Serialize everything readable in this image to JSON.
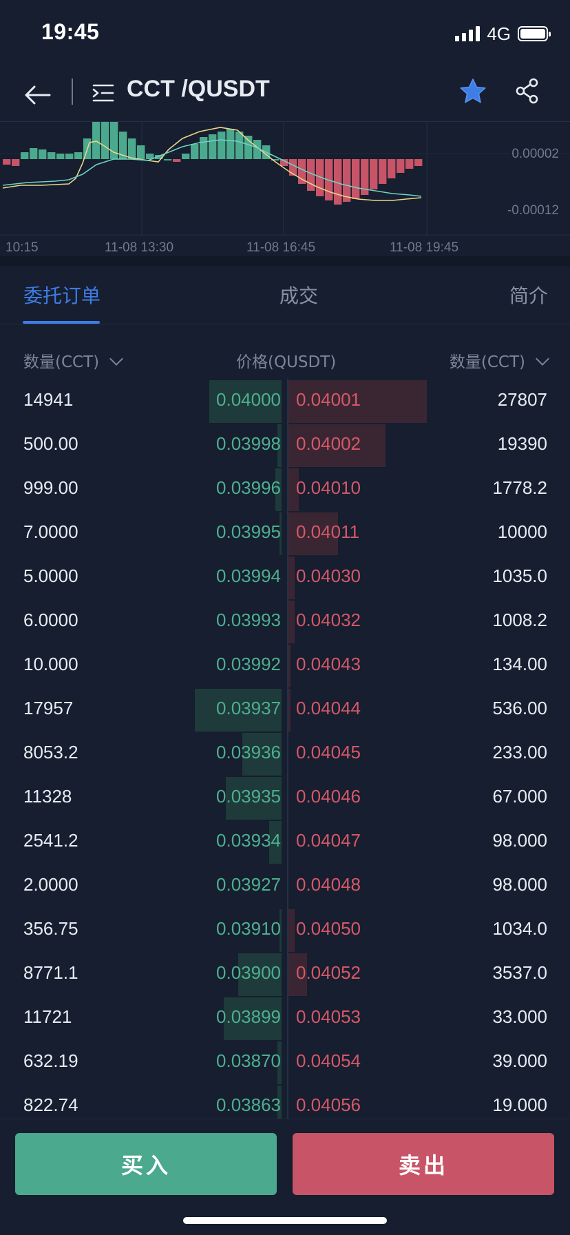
{
  "status_bar": {
    "time": "19:45",
    "network": "4G"
  },
  "header": {
    "pair": "CCT /QUSDT"
  },
  "chart": {
    "y_labels": [
      "0.00002",
      "-0.00012"
    ],
    "x_labels": [
      "10:15",
      "11-08 13:30",
      "11-08 16:45",
      "11-08 19:45"
    ]
  },
  "tabs": [
    "委托订单",
    "成交",
    "简介"
  ],
  "columns": {
    "left_qty": "数量(CCT)",
    "price": "价格(QUSDT)",
    "right_qty": "数量(CCT)"
  },
  "orderbook": [
    {
      "bid_qty": "14941",
      "bid": "0.04000",
      "ask": "0.04001",
      "ask_qty": "27807",
      "bid_depth": 0.35,
      "ask_depth": 0.67
    },
    {
      "bid_qty": "500.00",
      "bid": "0.03998",
      "ask": "0.04002",
      "ask_qty": "19390",
      "bid_depth": 0.02,
      "ask_depth": 0.47
    },
    {
      "bid_qty": "999.00",
      "bid": "0.03996",
      "ask": "0.04010",
      "ask_qty": "1778.2",
      "bid_depth": 0.03,
      "ask_depth": 0.05
    },
    {
      "bid_qty": "7.0000",
      "bid": "0.03995",
      "ask": "0.04011",
      "ask_qty": "10000",
      "bid_depth": 0.01,
      "ask_depth": 0.24
    },
    {
      "bid_qty": "5.0000",
      "bid": "0.03994",
      "ask": "0.04030",
      "ask_qty": "1035.0",
      "bid_depth": 0.0,
      "ask_depth": 0.03
    },
    {
      "bid_qty": "6.0000",
      "bid": "0.03993",
      "ask": "0.04032",
      "ask_qty": "1008.2",
      "bid_depth": 0.0,
      "ask_depth": 0.03
    },
    {
      "bid_qty": "10.000",
      "bid": "0.03992",
      "ask": "0.04043",
      "ask_qty": "134.00",
      "bid_depth": 0.0,
      "ask_depth": 0.01
    },
    {
      "bid_qty": "17957",
      "bid": "0.03937",
      "ask": "0.04044",
      "ask_qty": "536.00",
      "bid_depth": 0.42,
      "ask_depth": 0.01
    },
    {
      "bid_qty": "8053.2",
      "bid": "0.03936",
      "ask": "0.04045",
      "ask_qty": "233.00",
      "bid_depth": 0.19,
      "ask_depth": 0.0
    },
    {
      "bid_qty": "11328",
      "bid": "0.03935",
      "ask": "0.04046",
      "ask_qty": "67.000",
      "bid_depth": 0.27,
      "ask_depth": 0.0
    },
    {
      "bid_qty": "2541.2",
      "bid": "0.03934",
      "ask": "0.04047",
      "ask_qty": "98.000",
      "bid_depth": 0.06,
      "ask_depth": 0.0
    },
    {
      "bid_qty": "2.0000",
      "bid": "0.03927",
      "ask": "0.04048",
      "ask_qty": "98.000",
      "bid_depth": 0.0,
      "ask_depth": 0.0
    },
    {
      "bid_qty": "356.75",
      "bid": "0.03910",
      "ask": "0.04050",
      "ask_qty": "1034.0",
      "bid_depth": 0.01,
      "ask_depth": 0.03
    },
    {
      "bid_qty": "8771.1",
      "bid": "0.03900",
      "ask": "0.04052",
      "ask_qty": "3537.0",
      "bid_depth": 0.21,
      "ask_depth": 0.09
    },
    {
      "bid_qty": "11721",
      "bid": "0.03899",
      "ask": "0.04053",
      "ask_qty": "33.000",
      "bid_depth": 0.28,
      "ask_depth": 0.0
    },
    {
      "bid_qty": "632.19",
      "bid": "0.03870",
      "ask": "0.04054",
      "ask_qty": "39.000",
      "bid_depth": 0.02,
      "ask_depth": 0.0
    },
    {
      "bid_qty": "822.74",
      "bid": "0.03863",
      "ask": "0.04056",
      "ask_qty": "19.000",
      "bid_depth": 0.02,
      "ask_depth": 0.0
    }
  ],
  "actions": {
    "buy": "买入",
    "sell": "卖出"
  }
}
